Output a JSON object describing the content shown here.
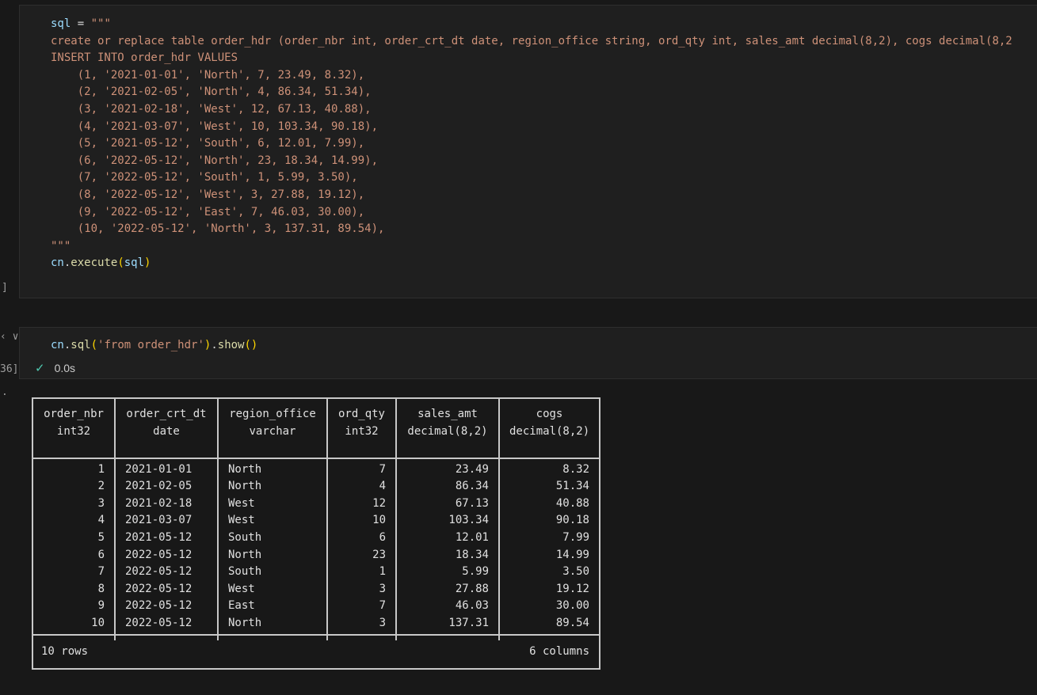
{
  "gutter": {
    "cell1_bracket": "]",
    "cell2_chevron": "‹ ∨",
    "cell2_exec_count": "36]",
    "output_marker": "."
  },
  "cell1": {
    "lines": [
      [
        {
          "t": "sql",
          "c": "var"
        },
        {
          "t": " = ",
          "c": "op"
        },
        {
          "t": "\"\"\"",
          "c": "str"
        }
      ],
      [
        {
          "t": "create or replace table order_hdr (order_nbr int, order_crt_dt date, region_office string, ord_qty int, sales_amt decimal(8,2), cogs decimal(8,2",
          "c": "str"
        }
      ],
      [
        {
          "t": "INSERT INTO order_hdr VALUES",
          "c": "str"
        }
      ],
      [
        {
          "t": "    (1, '2021-01-01', 'North', 7, 23.49, 8.32),",
          "c": "str"
        }
      ],
      [
        {
          "t": "    (2, '2021-02-05', 'North', 4, 86.34, 51.34),",
          "c": "str"
        }
      ],
      [
        {
          "t": "    (3, '2021-02-18', 'West', 12, 67.13, 40.88),",
          "c": "str"
        }
      ],
      [
        {
          "t": "    (4, '2021-03-07', 'West', 10, 103.34, 90.18),",
          "c": "str"
        }
      ],
      [
        {
          "t": "    (5, '2021-05-12', 'South', 6, 12.01, 7.99),",
          "c": "str"
        }
      ],
      [
        {
          "t": "    (6, '2022-05-12', 'North', 23, 18.34, 14.99),",
          "c": "str"
        }
      ],
      [
        {
          "t": "    (7, '2022-05-12', 'South', 1, 5.99, 3.50),",
          "c": "str"
        }
      ],
      [
        {
          "t": "    (8, '2022-05-12', 'West', 3, 27.88, 19.12),",
          "c": "str"
        }
      ],
      [
        {
          "t": "    (9, '2022-05-12', 'East', 7, 46.03, 30.00),",
          "c": "str"
        }
      ],
      [
        {
          "t": "    (10, '2022-05-12', 'North', 3, 137.31, 89.54),",
          "c": "str"
        }
      ],
      [
        {
          "t": "\"\"\"",
          "c": "str"
        }
      ],
      [
        {
          "t": "cn",
          "c": "var"
        },
        {
          "t": ".",
          "c": "op"
        },
        {
          "t": "execute",
          "c": "fn"
        },
        {
          "t": "(",
          "c": "par"
        },
        {
          "t": "sql",
          "c": "var"
        },
        {
          "t": ")",
          "c": "par"
        }
      ]
    ]
  },
  "cell2": {
    "lines": [
      [
        {
          "t": "cn",
          "c": "var"
        },
        {
          "t": ".",
          "c": "op"
        },
        {
          "t": "sql",
          "c": "fn"
        },
        {
          "t": "(",
          "c": "par"
        },
        {
          "t": "'from order_hdr'",
          "c": "str"
        },
        {
          "t": ")",
          "c": "par"
        },
        {
          "t": ".",
          "c": "op"
        },
        {
          "t": "show",
          "c": "fn"
        },
        {
          "t": "()",
          "c": "par"
        }
      ]
    ],
    "status_time": "0.0s"
  },
  "output": {
    "columns": [
      {
        "name": "order_nbr",
        "type": "int32",
        "align": "num"
      },
      {
        "name": "order_crt_dt",
        "type": "date",
        "align": "txt"
      },
      {
        "name": "region_office",
        "type": "varchar",
        "align": "txt"
      },
      {
        "name": "ord_qty",
        "type": "int32",
        "align": "num"
      },
      {
        "name": "sales_amt",
        "type": "decimal(8,2)",
        "align": "num"
      },
      {
        "name": "cogs",
        "type": "decimal(8,2)",
        "align": "num"
      }
    ],
    "rows": [
      [
        "1",
        "2021-01-01",
        "North",
        "7",
        "23.49",
        "8.32"
      ],
      [
        "2",
        "2021-02-05",
        "North",
        "4",
        "86.34",
        "51.34"
      ],
      [
        "3",
        "2021-02-18",
        "West",
        "12",
        "67.13",
        "40.88"
      ],
      [
        "4",
        "2021-03-07",
        "West",
        "10",
        "103.34",
        "90.18"
      ],
      [
        "5",
        "2021-05-12",
        "South",
        "6",
        "12.01",
        "7.99"
      ],
      [
        "6",
        "2022-05-12",
        "North",
        "23",
        "18.34",
        "14.99"
      ],
      [
        "7",
        "2022-05-12",
        "South",
        "1",
        "5.99",
        "3.50"
      ],
      [
        "8",
        "2022-05-12",
        "West",
        "3",
        "27.88",
        "19.12"
      ],
      [
        "9",
        "2022-05-12",
        "East",
        "7",
        "46.03",
        "30.00"
      ],
      [
        "10",
        "2022-05-12",
        "North",
        "3",
        "137.31",
        "89.54"
      ]
    ],
    "footer_rows": "10 rows",
    "footer_cols": "6 columns"
  },
  "colors": {
    "background": "#181818",
    "cell_background": "#1f1f1f",
    "string": "#ce9178",
    "variable": "#9cdcfe",
    "function": "#dcdcaa",
    "bracket": "#ffd700",
    "success": "#4ec9b0"
  }
}
